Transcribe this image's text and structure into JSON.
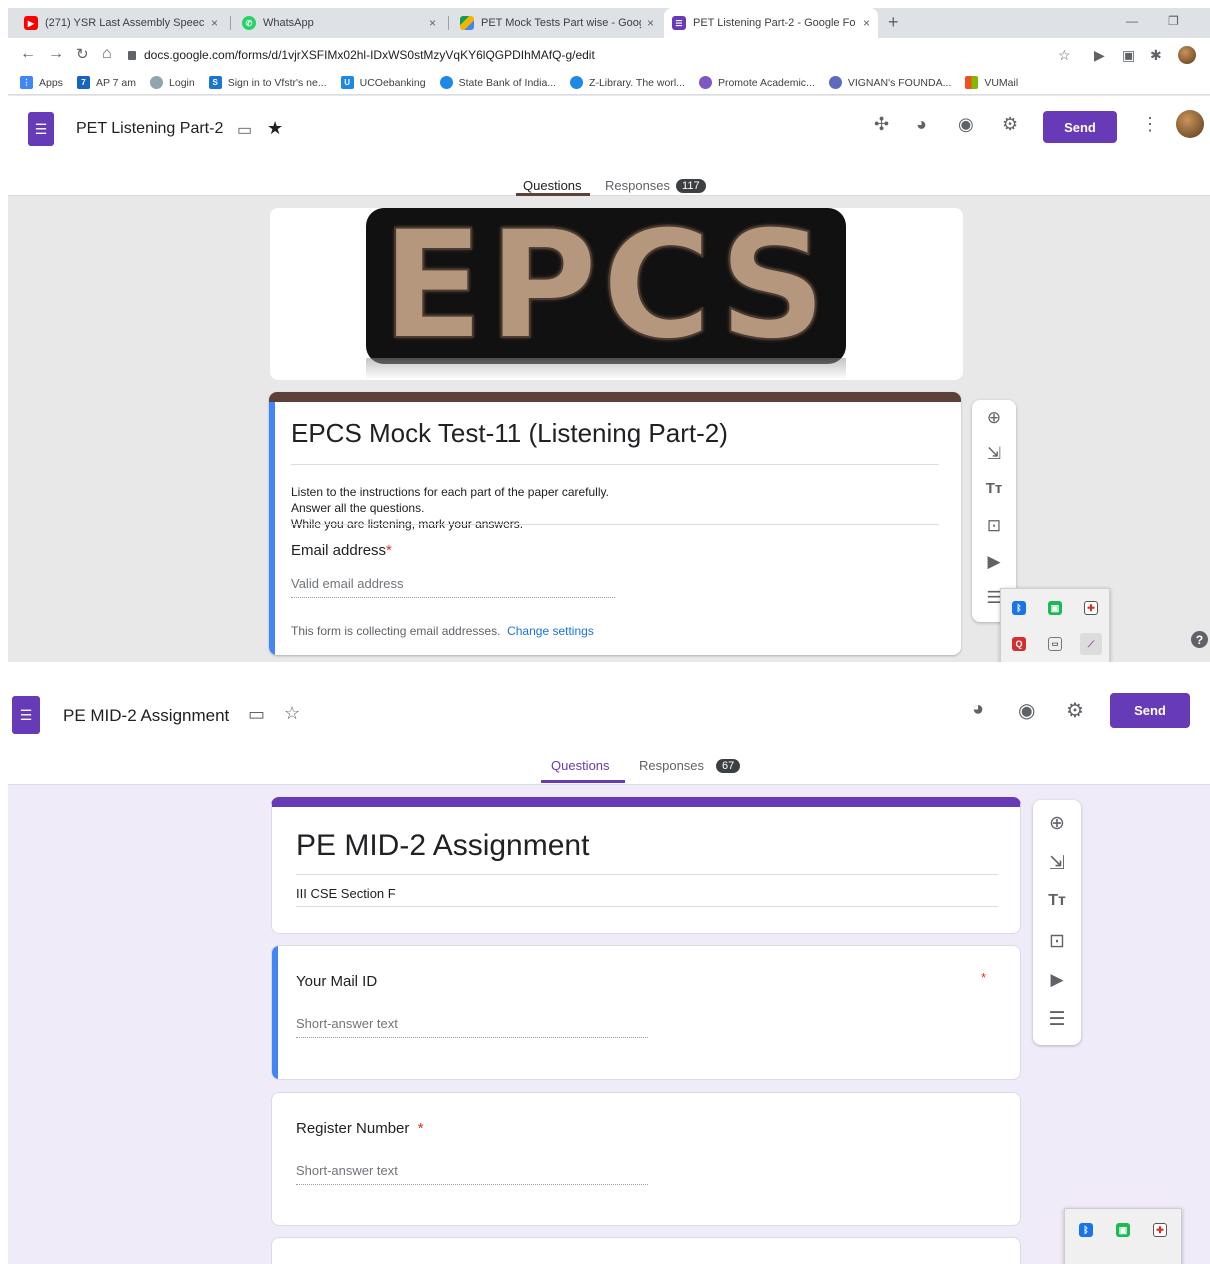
{
  "browser": {
    "tabs": [
      {
        "title": "(271) YSR Last Assembly Speech",
        "favicon_color": "#ff0000",
        "close": "×"
      },
      {
        "title": "WhatsApp",
        "favicon_color": "#25d366",
        "close": "×"
      },
      {
        "title": "PET Mock Tests Part wise - Goog",
        "favicon_color": "#f4b400",
        "close": "×"
      },
      {
        "title": "PET Listening Part-2 - Google Fo",
        "favicon_color": "#673ab7",
        "close": "×"
      }
    ],
    "new_tab": "+",
    "url": "docs.google.com/forms/d/1vjrXSFIMx02hl-IDxWS0stMzyVqKY6lQGPDIhMAfQ-g/edit",
    "bookmarks": [
      {
        "label": "Apps",
        "color": "#4285f4"
      },
      {
        "label": "AP 7 am",
        "color": "#1565c0"
      },
      {
        "label": "Login",
        "color": "#90a4ae"
      },
      {
        "label": "Sign in to Vfstr's ne...",
        "color": "#1976d2"
      },
      {
        "label": "UCOebanking",
        "color": "#1e88e5"
      },
      {
        "label": "State Bank of India...",
        "color": "#1e88e5"
      },
      {
        "label": "Z-Library. The worl...",
        "color": "#1e88e5"
      },
      {
        "label": "Promote Academic...",
        "color": "#7e57c2"
      },
      {
        "label": "VIGNAN's FOUNDA...",
        "color": "#5c6bc0"
      },
      {
        "label": "VUMail",
        "color": "#f25022"
      }
    ]
  },
  "form1": {
    "title": "PET Listening Part-2",
    "send_label": "Send",
    "tab_questions": "Questions",
    "tab_responses": "Responses",
    "responses_count": "117",
    "banner_text": "EPCS",
    "heading": "EPCS Mock Test-11 (Listening Part-2)",
    "description": [
      "Listen to the instructions for each part of the paper carefully.",
      "Answer all the questions.",
      "While you are listening, mark your answers."
    ],
    "email_label": "Email address",
    "required_mark": "*",
    "email_placeholder": "Valid email address",
    "collecting_note": "This form is collecting email addresses.",
    "change_settings": "Change settings"
  },
  "form2": {
    "title": "PE MID-2 Assignment",
    "send_label": "Send",
    "tab_questions": "Questions",
    "tab_responses": "Responses",
    "responses_count": "67",
    "heading": "PE MID-2 Assignment",
    "description": "III CSE Section F",
    "questions": [
      {
        "label": "Your Mail ID",
        "required": "*",
        "placeholder": "Short-answer text"
      },
      {
        "label": "Register Number",
        "required": "*",
        "placeholder": "Short-answer text"
      }
    ]
  },
  "colors": {
    "brand": "#673ab7",
    "active_question": "#4285f4",
    "header_theme1": "#5d4037"
  }
}
